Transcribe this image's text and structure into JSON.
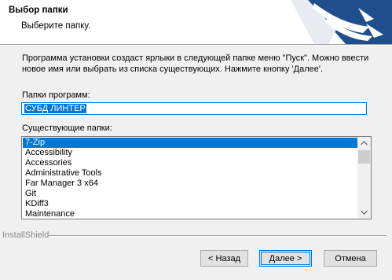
{
  "header": {
    "title": "Выбор папки",
    "subtitle": "Выберите папку."
  },
  "instructions": "Программа установки создаст ярлыки в следующей папке меню \"Пуск\".  Можно ввести новое имя или выбрать из списка существующих. Нажмите кнопку 'Далее'.",
  "program_folder": {
    "label": "Папки программ:",
    "value": "СУБД ЛИНТЕР"
  },
  "existing_folders": {
    "label": "Существующие папки:",
    "items": [
      "7-Zip",
      "Accessibility",
      "Accessories",
      "Administrative Tools",
      "Far Manager 3 x64",
      "Git",
      "KDiff3",
      "Maintenance"
    ],
    "selected_index": 0
  },
  "footer": {
    "brand": "InstallShield"
  },
  "buttons": {
    "back": "< Назад",
    "next": "Далее >",
    "cancel": "Отмена"
  },
  "colors": {
    "accent": "#0078d7",
    "logo_blue": "#1f4e8c",
    "window_bg": "#f0f0f0"
  },
  "icons": {
    "logo": "installshield-swoosh-logo",
    "scroll_up": "chevron-up-icon",
    "scroll_down": "chevron-down-icon"
  }
}
